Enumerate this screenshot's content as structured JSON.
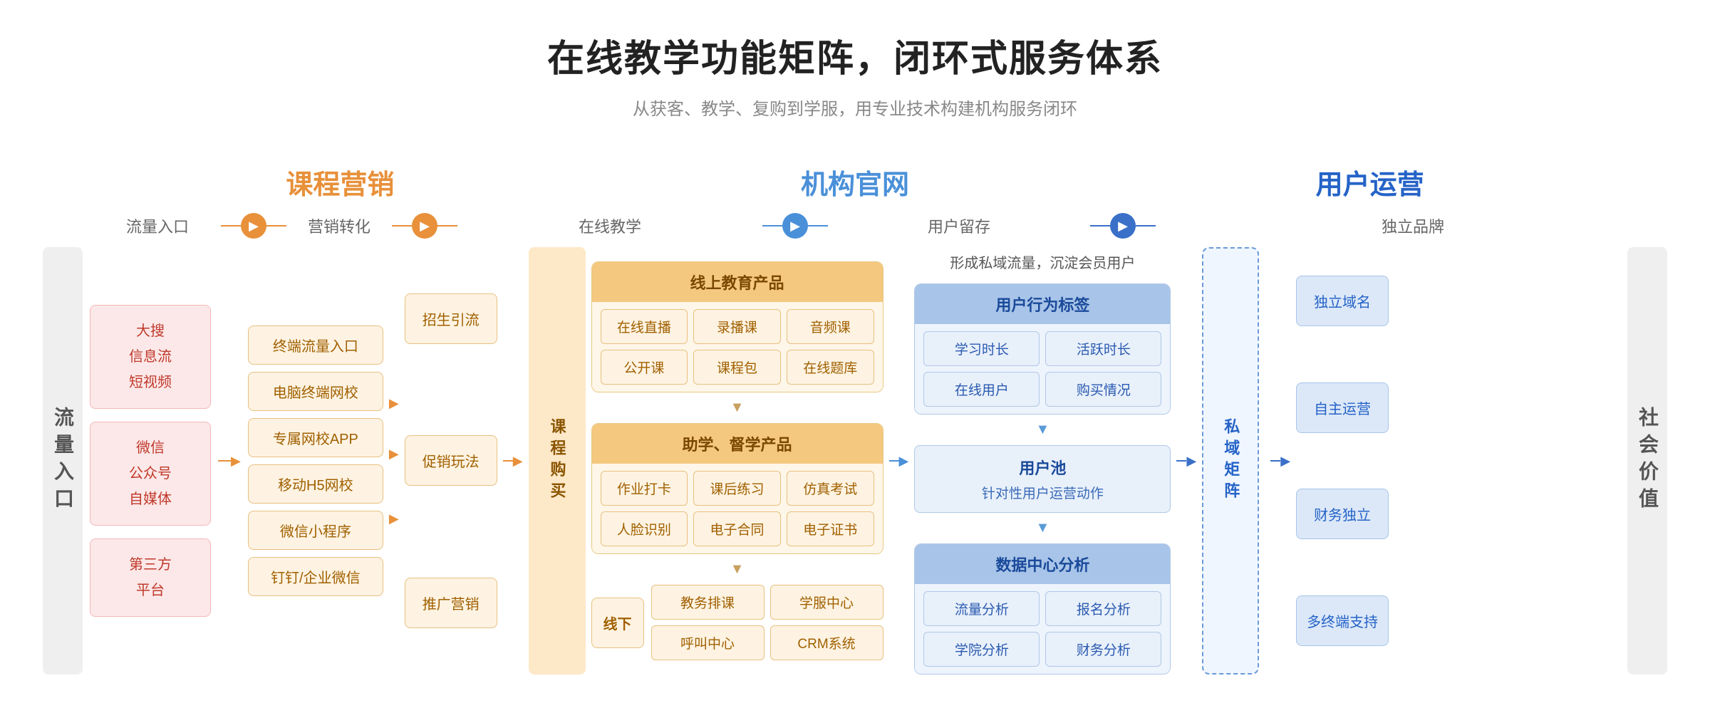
{
  "header": {
    "title": "在线教学功能矩阵，闭环式服务体系",
    "subtitle": "从获客、教学、复购到学服，用专业技术构建机构服务闭环"
  },
  "categories": [
    {
      "id": "marketing",
      "label": "课程营销",
      "color": "orange"
    },
    {
      "id": "website",
      "label": "机构官网",
      "color": "blue"
    },
    {
      "id": "user-ops",
      "label": "用户运营",
      "color": "dark-blue"
    }
  ],
  "flow_labels": [
    {
      "id": "traffic-entry",
      "label": "流量入口"
    },
    {
      "id": "marketing-convert",
      "label": "营销转化"
    },
    {
      "id": "online-teach",
      "label": "在线教学"
    },
    {
      "id": "user-retain",
      "label": "用户留存"
    },
    {
      "id": "brand",
      "label": "独立品牌"
    }
  ],
  "left_label": "流量入口",
  "right_label": "社会价值",
  "traffic_sources": [
    {
      "id": "search-feed",
      "label": "大搜\n信息流\n短视频"
    },
    {
      "id": "wechat-media",
      "label": "微信\n公众号\n自媒体"
    },
    {
      "id": "third-party",
      "label": "第三方\n平台"
    }
  ],
  "marketing_items": [
    {
      "id": "terminal-traffic",
      "label": "终端流量入口"
    },
    {
      "id": "pc-school",
      "label": "电脑终端网校"
    },
    {
      "id": "app",
      "label": "专属网校APP"
    },
    {
      "id": "mobile-school",
      "label": "移动H5网校"
    },
    {
      "id": "mini-program",
      "label": "微信小程序"
    },
    {
      "id": "dingtalk",
      "label": "钉钉/企业微信"
    }
  ],
  "conversion_items": [
    {
      "id": "recruit",
      "label": "招生引流"
    },
    {
      "id": "promo-play",
      "label": "促销玩法"
    },
    {
      "id": "promo-marketing",
      "label": "推广营销"
    }
  ],
  "course_buy_label": "课程购买",
  "online_teaching": {
    "header": "线上教育产品",
    "items_row1": [
      "在线直播",
      "录播课",
      "音频课"
    ],
    "items_row2": [
      "公开课",
      "课程包",
      "在线题库"
    ],
    "sub_header": "助学、督学产品",
    "sub_items_row1": [
      "作业打卡",
      "课后练习",
      "仿真考试"
    ],
    "sub_items_row2": [
      "人脸识别",
      "电子合同",
      "电子证书"
    ],
    "offline_label": "线下",
    "offline_items_row1": [
      "教务排课",
      "学服中心"
    ],
    "offline_items_row2": [
      "呼叫中心",
      "CRM系统"
    ]
  },
  "user_retention": {
    "promo_text": "形成私域流量，沉淀会员用户",
    "behavior_header": "用户行为标签",
    "behavior_items": [
      "学习时长",
      "活跃时长",
      "在线用户",
      "购买情况"
    ],
    "user_pool_header": "用户池",
    "user_pool_sub": "针对性用户运营动作",
    "data_center_header": "数据中心分析",
    "data_items": [
      "流量分析",
      "报名分析",
      "学院分析",
      "财务分析"
    ]
  },
  "private_matrix_label": "私域矩阵",
  "brand_items": [
    {
      "id": "independent-domain",
      "label": "独立域名"
    },
    {
      "id": "self-ops",
      "label": "自主运营"
    },
    {
      "id": "financial-independent",
      "label": "财务独立"
    },
    {
      "id": "multi-terminal",
      "label": "多终端支持"
    }
  ],
  "arrows": {
    "orange_circle": "▶",
    "blue_circle": "▶",
    "dark_blue_circle": "▶",
    "small_right": "▶",
    "small_down": "▼"
  }
}
